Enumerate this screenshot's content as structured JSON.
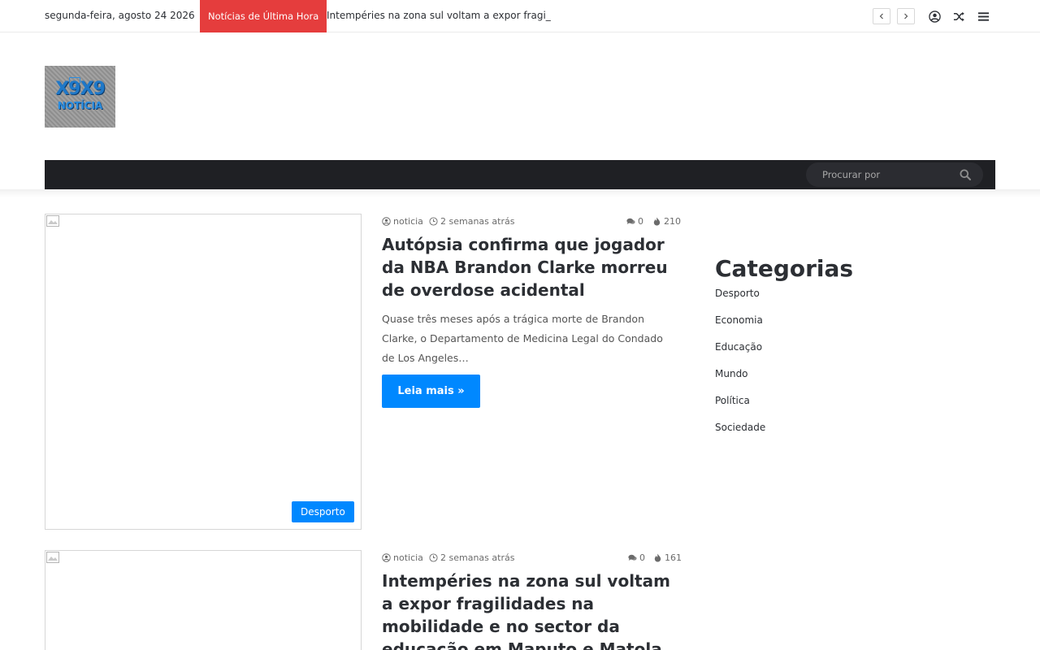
{
  "topbar": {
    "date": "segunda-feira, agosto 24 2026",
    "breaking_label": "Notícias de Última Hora",
    "breaking_text": "Intempéries na zona sul voltam a expor fragi_"
  },
  "logo": {
    "line1": "X9X9",
    "line2": "NOTÍCIA"
  },
  "search": {
    "placeholder": "Procurar por"
  },
  "posts": [
    {
      "author": "noticia",
      "time": "2 semanas atrás",
      "comments": "0",
      "views": "210",
      "title": "Autópsia confirma que jogador da NBA Brandon Clarke morreu de overdose acidental",
      "excerpt": "Quase três meses após a trágica morte de Brandon Clarke, o Departamento de Medicina Legal do Condado de Los Angeles…",
      "read_more": "Leia mais »",
      "category": "Desporto"
    },
    {
      "author": "noticia",
      "time": "2 semanas atrás",
      "comments": "0",
      "views": "161",
      "title": "Intempéries na zona sul voltam a expor fragilidades na mobilidade e no sector da educação em Maputo e Matola"
    }
  ],
  "sidebar": {
    "title": "Categorias",
    "categories": [
      "Desporto",
      "Economia",
      "Educação",
      "Mundo",
      "Política",
      "Sociedade"
    ]
  },
  "colors": {
    "accent": "#0088ff",
    "breaking": "#e53d3d",
    "nav": "#1f2024"
  }
}
